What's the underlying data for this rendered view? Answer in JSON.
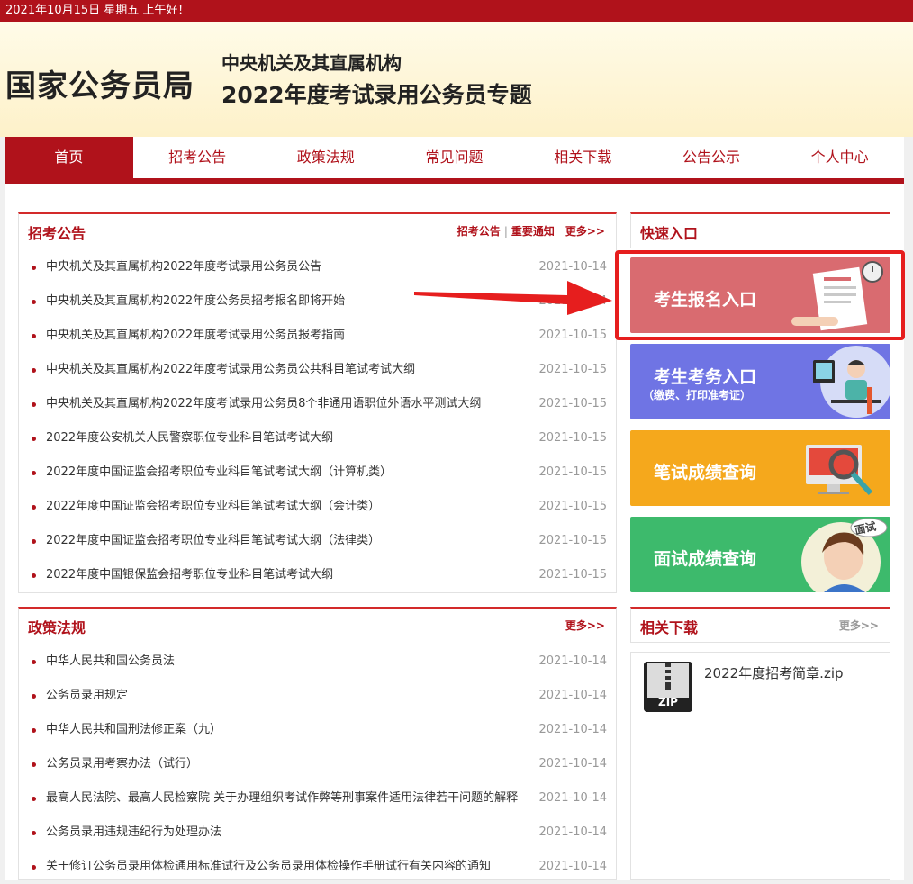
{
  "topbar": {
    "greeting": "2021年10月15日  星期五  上午好！"
  },
  "header": {
    "logo": "国家公务员局",
    "subtitle1": "中央机关及其直属机构",
    "subtitle2": "2022年度考试录用公务员专题"
  },
  "nav": {
    "items": [
      "首页",
      "招考公告",
      "政策法规",
      "常见问题",
      "相关下载",
      "公告公示",
      "个人中心"
    ],
    "active": "首页"
  },
  "announcements": {
    "title": "招考公告",
    "link1": "招考公告",
    "link2": "重要通知",
    "more": "更多>>",
    "items": [
      {
        "title": "中央机关及其直属机构2022年度考试录用公务员公告",
        "date": "2021-10-14"
      },
      {
        "title": "中央机关及其直属机构2022年度公务员招考报名即将开始",
        "date": "2021-10-14"
      },
      {
        "title": "中央机关及其直属机构2022年度考试录用公务员报考指南",
        "date": "2021-10-15"
      },
      {
        "title": "中央机关及其直属机构2022年度考试录用公务员公共科目笔试考试大纲",
        "date": "2021-10-15"
      },
      {
        "title": "中央机关及其直属机构2022年度考试录用公务员8个非通用语职位外语水平测试大纲",
        "date": "2021-10-15"
      },
      {
        "title": "2022年度公安机关人民警察职位专业科目笔试考试大纲",
        "date": "2021-10-15"
      },
      {
        "title": "2022年度中国证监会招考职位专业科目笔试考试大纲（计算机类）",
        "date": "2021-10-15"
      },
      {
        "title": "2022年度中国证监会招考职位专业科目笔试考试大纲（会计类）",
        "date": "2021-10-15"
      },
      {
        "title": "2022年度中国证监会招考职位专业科目笔试考试大纲（法律类）",
        "date": "2021-10-15"
      },
      {
        "title": "2022年度中国银保监会招考职位专业科目笔试考试大纲",
        "date": "2021-10-15"
      }
    ]
  },
  "policies": {
    "title": "政策法规",
    "more": "更多>>",
    "items": [
      {
        "title": "中华人民共和国公务员法",
        "date": "2021-10-14"
      },
      {
        "title": "公务员录用规定",
        "date": "2021-10-14"
      },
      {
        "title": "中华人民共和国刑法修正案（九）",
        "date": "2021-10-14"
      },
      {
        "title": "公务员录用考察办法（试行）",
        "date": "2021-10-14"
      },
      {
        "title": "最高人民法院、最高人民检察院 关于办理组织考试作弊等刑事案件适用法律若干问题的解释",
        "date": "2021-10-14"
      },
      {
        "title": "公务员录用违规违纪行为处理办法",
        "date": "2021-10-14"
      },
      {
        "title": "关于修订公务员录用体检通用标准试行及公务员录用体检操作手册试行有关内容的通知",
        "date": "2021-10-14"
      }
    ]
  },
  "quick": {
    "title": "快速入口",
    "buttons": [
      {
        "label": "考生报名入口",
        "sub": "",
        "color": "#d96b70"
      },
      {
        "label": "考生考务入口",
        "sub": "（缴费、打印准考证）",
        "color": "#6f74e4"
      },
      {
        "label": "笔试成绩查询",
        "sub": "",
        "color": "#f5a81c"
      },
      {
        "label": "面试成绩查询",
        "sub": "",
        "color": "#3dba6c",
        "badge": "面试"
      }
    ]
  },
  "downloads": {
    "title": "相关下载",
    "more": "更多>>",
    "file": {
      "name": "2022年度招考简章.zip",
      "icon_label": "ZIP"
    }
  },
  "colors": {
    "brand": "#b0121b",
    "highlight": "#e61e1e"
  }
}
